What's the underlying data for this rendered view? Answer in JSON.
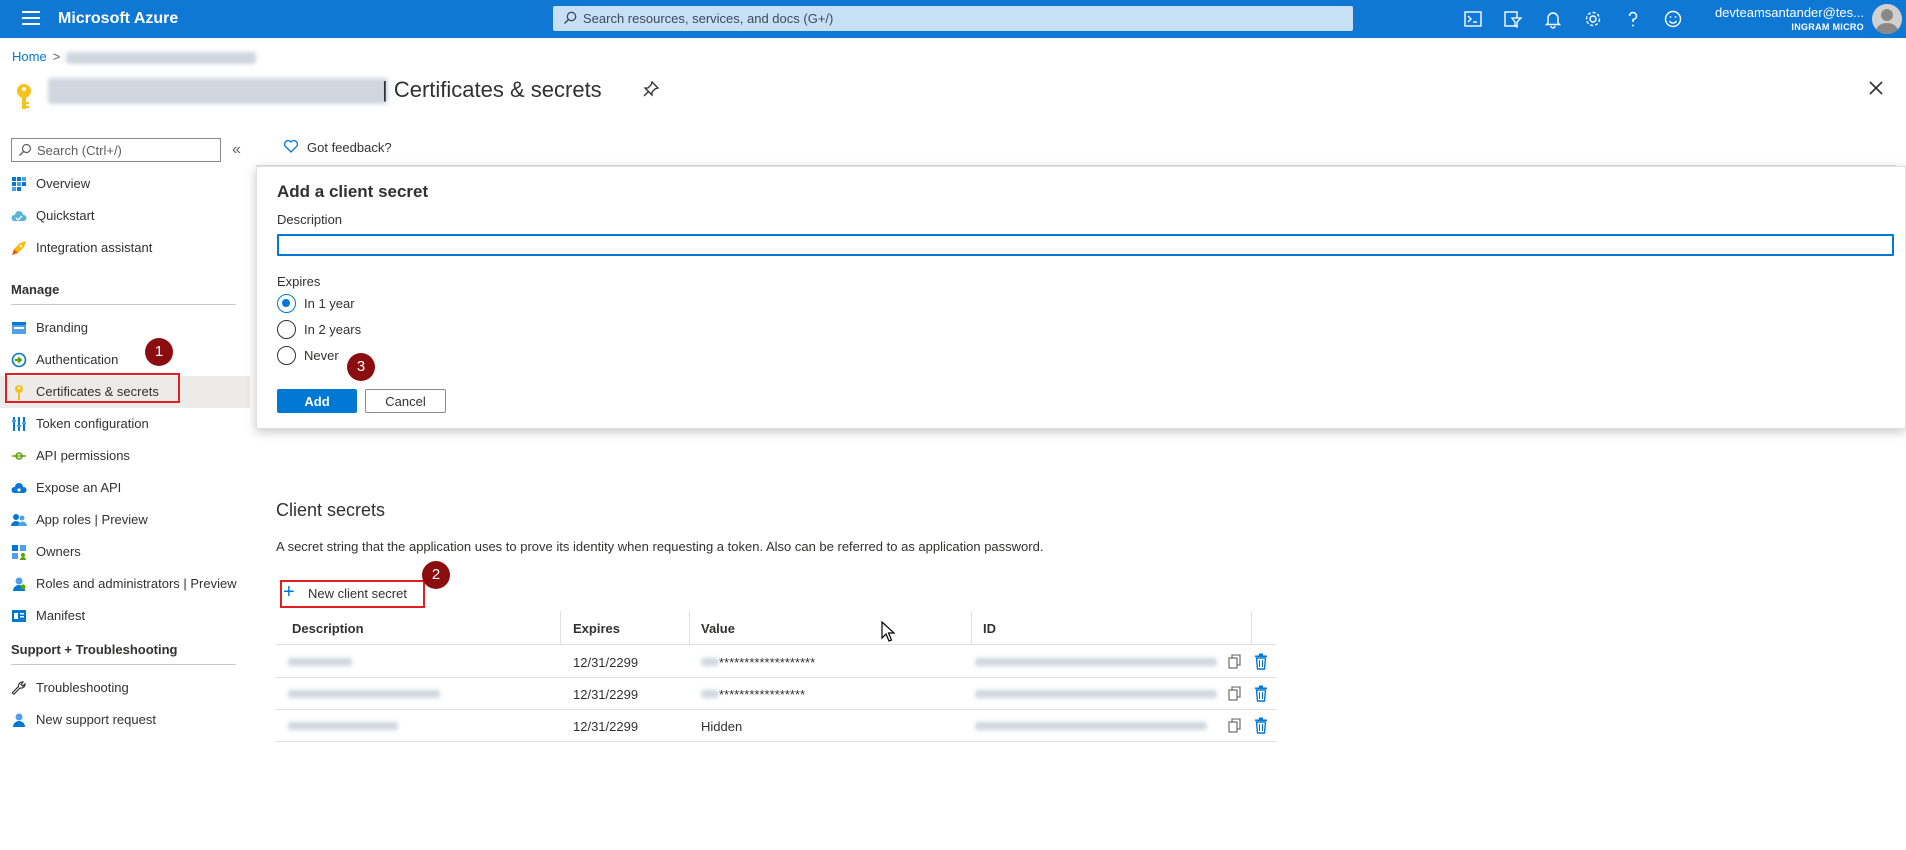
{
  "topbar": {
    "brand": "Microsoft Azure",
    "search_placeholder": "Search resources, services, and docs (G+/)",
    "icons": [
      "cloud-shell-icon",
      "directory-filter-icon",
      "notifications-icon",
      "settings-icon",
      "help-icon",
      "feedback-smiley-icon"
    ],
    "account_user": "devteamsantander@tes...",
    "account_org": "INGRAM MICRO"
  },
  "breadcrumb": {
    "home": "Home",
    "separator": ">"
  },
  "page": {
    "title_separator": "|",
    "title": "Certificates & secrets"
  },
  "sidebar": {
    "search_placeholder": "Search (Ctrl+/)",
    "collapse": "«",
    "items_top": [
      {
        "label": "Overview",
        "icon": "overview-grid-icon"
      },
      {
        "label": "Quickstart",
        "icon": "quickstart-cloud-icon"
      },
      {
        "label": "Integration assistant",
        "icon": "rocket-icon"
      }
    ],
    "manage_heading": "Manage",
    "items_manage": [
      {
        "label": "Branding",
        "icon": "branding-icon"
      },
      {
        "label": "Authentication",
        "icon": "authentication-icon"
      },
      {
        "label": "Certificates & secrets",
        "icon": "key-icon",
        "selected": true
      },
      {
        "label": "Token configuration",
        "icon": "token-bars-icon"
      },
      {
        "label": "API permissions",
        "icon": "api-permissions-icon"
      },
      {
        "label": "Expose an API",
        "icon": "expose-api-cloud-icon"
      },
      {
        "label": "App roles | Preview",
        "icon": "app-roles-icon"
      },
      {
        "label": "Owners",
        "icon": "owners-icon"
      },
      {
        "label": "Roles and administrators | Preview",
        "icon": "roles-admin-icon"
      },
      {
        "label": "Manifest",
        "icon": "manifest-icon"
      }
    ],
    "support_heading": "Support + Troubleshooting",
    "items_support": [
      {
        "label": "Troubleshooting",
        "icon": "wrench-icon"
      },
      {
        "label": "New support request",
        "icon": "support-person-icon"
      }
    ]
  },
  "feedback": {
    "label": "Got feedback?"
  },
  "panel": {
    "title": "Add a client secret",
    "description_label": "Description",
    "description_value": "",
    "expires_label": "Expires",
    "options": [
      {
        "label": "In 1 year",
        "checked": true
      },
      {
        "label": "In 2 years",
        "checked": false
      },
      {
        "label": "Never",
        "checked": false
      }
    ],
    "add_label": "Add",
    "cancel_label": "Cancel"
  },
  "client_secrets": {
    "title": "Client secrets",
    "description": "A secret string that the application uses to prove its identity when requesting a token. Also can be referred to as application password.",
    "new_button": "New client secret",
    "columns": [
      "Description",
      "Expires",
      "Value",
      "ID"
    ],
    "rows": [
      {
        "expires": "12/31/2299",
        "value": "*******************"
      },
      {
        "expires": "12/31/2299",
        "value": "*****************"
      },
      {
        "expires": "12/31/2299",
        "value": "Hidden"
      }
    ]
  },
  "annotations": [
    "1",
    "2",
    "3"
  ],
  "colors": {
    "topbar": "#0f78d4",
    "accent": "#0078d4",
    "annotation_box": "#e02020",
    "annotation_badge": "#8b0d10"
  }
}
